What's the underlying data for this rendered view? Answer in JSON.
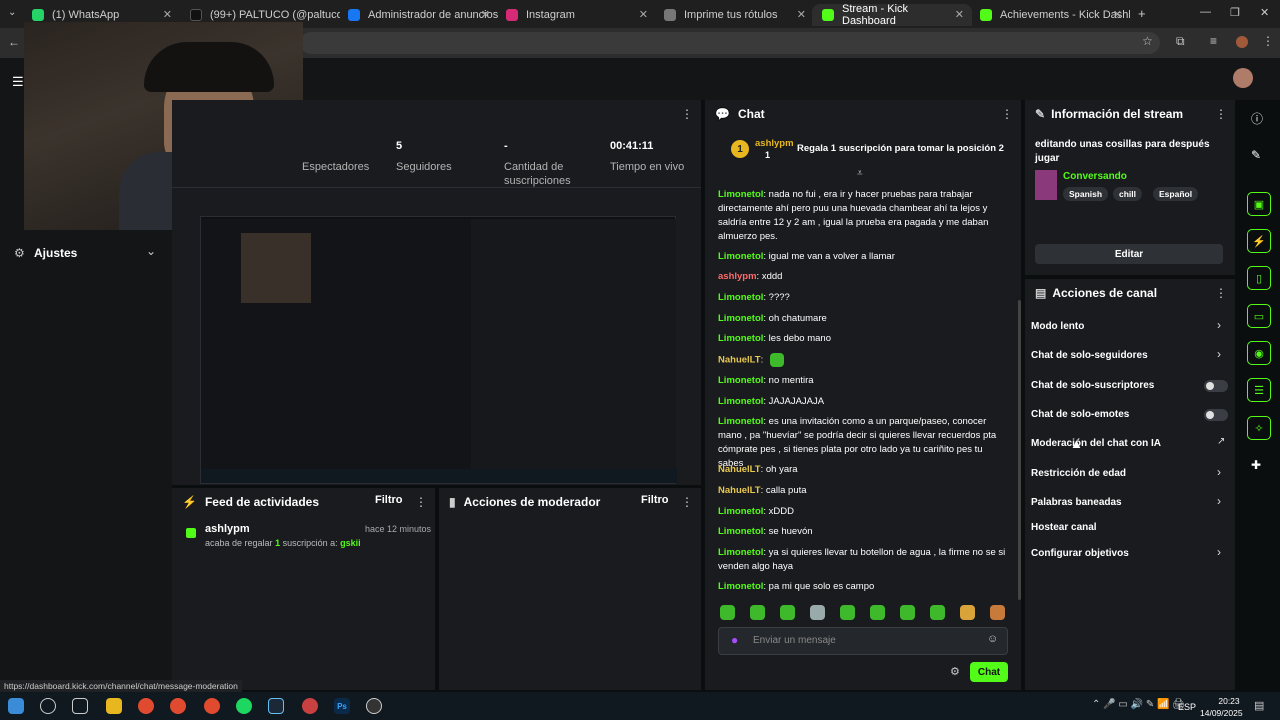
{
  "browser": {
    "tabs": [
      {
        "label": "(1) WhatsApp",
        "color": "#25d366"
      },
      {
        "label": "(99+) PALTUCO (@paltuco) | Tik",
        "color": "#111111"
      },
      {
        "label": "Administrador de anuncios - A",
        "color": "#1877f2"
      },
      {
        "label": "Instagram",
        "color": "#d62976"
      },
      {
        "label": "Imprime tus rótulos",
        "color": "#777777"
      },
      {
        "label": "Stream - Kick Dashboard",
        "color": "#53fc18"
      },
      {
        "label": "Achievements - Kick Dashboar",
        "color": "#53fc18"
      }
    ],
    "status_url": "https://dashboard.kick.com/channel/chat/message-moderation"
  },
  "sidebar": {
    "settings_label": "Ajustes"
  },
  "stats": [
    {
      "value": "",
      "label": "Espectadores"
    },
    {
      "value": "5",
      "label": "Seguidores"
    },
    {
      "value": "-",
      "label": "Cantidad de suscripciones"
    },
    {
      "value": "00:41:11",
      "label": "Tiempo en vivo"
    }
  ],
  "activity_feed": {
    "title": "Feed de actividades",
    "filter": "Filtro",
    "items": [
      {
        "user": "ashlypm",
        "time": "hace 12 minutos",
        "text": "acaba de regalar",
        "count": "1",
        "text2": "suscripción a:",
        "target": "gskii"
      }
    ]
  },
  "mod_actions": {
    "title": "Acciones de moderador",
    "filter": "Filtro"
  },
  "chat": {
    "title": "Chat",
    "pinned": {
      "rank": "1",
      "user": "ashlypm",
      "sub_count": "1",
      "text": "Regala 1 suscripción para tomar la posición 2"
    },
    "messages": [
      {
        "user": "Limonetol",
        "text": "nada no fui , era ir y hacer pruebas para trabajar directamente ahí pero puu una huevada chambear ahí ta lejos y saldría entre 12 y 2 am , igual la prueba era pagada y me daban almuerzo pes.",
        "cls": "u"
      },
      {
        "user": "Limonetol",
        "text": "igual me van a volver a llamar",
        "cls": "u"
      },
      {
        "user": "ashlypm",
        "text": "xddd",
        "cls": "u p"
      },
      {
        "user": "Limonetol",
        "text": "????",
        "cls": "u"
      },
      {
        "user": "Limonetol",
        "text": "oh chatumare",
        "cls": "u"
      },
      {
        "user": "Limonetol",
        "text": "les debo mano",
        "cls": "u"
      },
      {
        "user": "NahuelLT",
        "text": "",
        "cls": "u b"
      },
      {
        "user": "Limonetol",
        "text": "no mentira",
        "cls": "u"
      },
      {
        "user": "Limonetol",
        "text": "JAJAJAJAJA",
        "cls": "u"
      },
      {
        "user": "Limonetol",
        "text": "es una invitación como a un parque/paseo, conocer mano , pa \"huevíar\" se podría decir si quieres llevar recuerdos pta cómprate pes , si tienes plata por otro lado ya tu cariñito pes tu sabes",
        "cls": "u"
      },
      {
        "user": "NahuelLT",
        "text": "oh yara",
        "cls": "u b"
      },
      {
        "user": "NahuelLT",
        "text": "calla puta",
        "cls": "u b"
      },
      {
        "user": "Limonetol",
        "text": "xDDD",
        "cls": "u"
      },
      {
        "user": "Limonetol",
        "text": "se huevón",
        "cls": "u"
      },
      {
        "user": "Limonetol",
        "text": "ya si quieres llevar tu botellon de agua , la firme no se si venden algo haya",
        "cls": "u"
      },
      {
        "user": "Limonetol",
        "text": "pa mi que solo es campo",
        "cls": "u"
      }
    ],
    "input_placeholder": "Enviar un mensaje",
    "send_label": "Chat"
  },
  "stream_info": {
    "title": "Información del stream",
    "stream_title": "editando unas cosillas para después jugar",
    "category": "Conversando",
    "tags": [
      "Spanish",
      "chill",
      "Español"
    ],
    "edit_label": "Editar"
  },
  "channel_actions": {
    "title": "Acciones de canal",
    "items": [
      {
        "label": "Modo lento",
        "control": "chevron"
      },
      {
        "label": "Chat de solo-seguidores",
        "control": "chevron"
      },
      {
        "label": "Chat de solo-suscriptores",
        "control": "toggle"
      },
      {
        "label": "Chat de solo-emotes",
        "control": "toggle"
      },
      {
        "label": "Moderación del chat con IA",
        "control": "external"
      },
      {
        "label": "Restricción de edad",
        "control": "chevron"
      },
      {
        "label": "Palabras baneadas",
        "control": "chevron"
      },
      {
        "label": "Hostear canal",
        "control": "none"
      },
      {
        "label": "Configurar objetivos",
        "control": "chevron"
      }
    ]
  },
  "taskbar": {
    "lang": "ESP",
    "time": "20:23",
    "date": "14/09/2025"
  },
  "colors": {
    "accent": "#53fc18",
    "panel": "#191b1f",
    "bg": "#0b0e0f"
  }
}
